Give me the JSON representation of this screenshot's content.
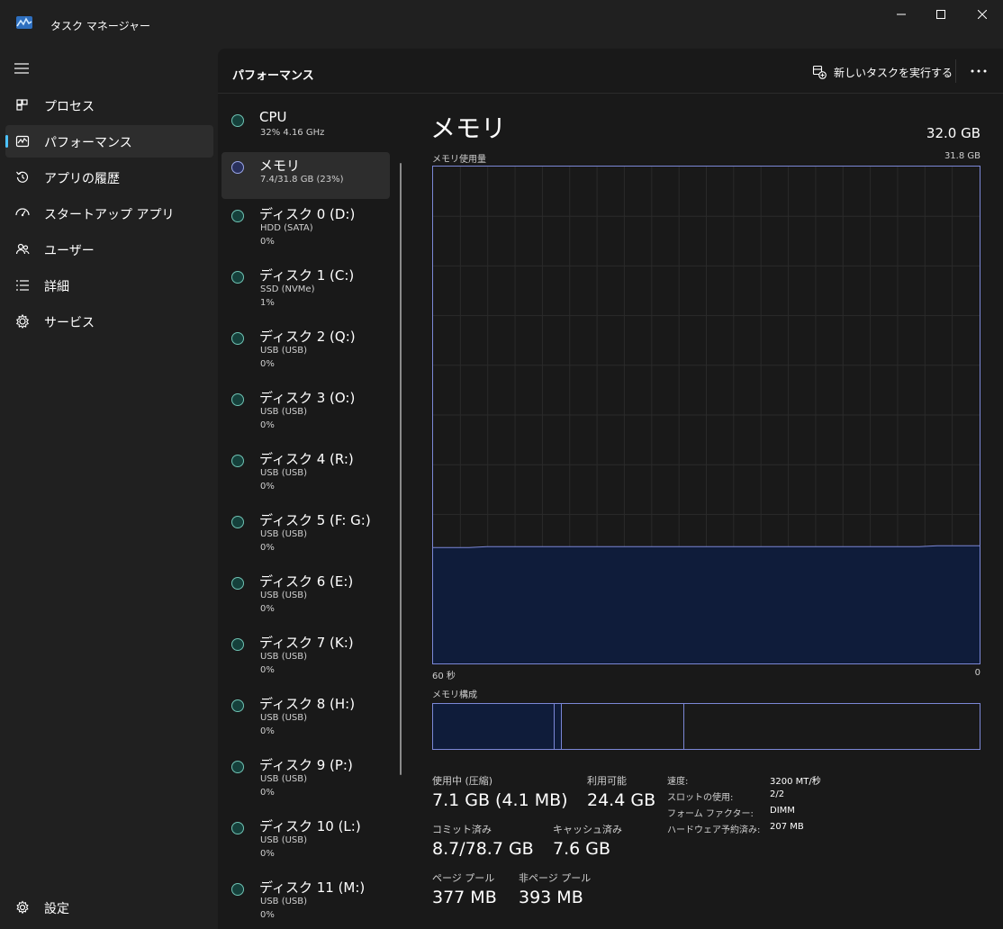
{
  "window": {
    "title": "タスク マネージャー"
  },
  "sidebar": {
    "items": [
      {
        "label": "プロセス",
        "icon": "processes-icon"
      },
      {
        "label": "パフォーマンス",
        "icon": "performance-icon",
        "active": true
      },
      {
        "label": "アプリの履歴",
        "icon": "app-history-icon"
      },
      {
        "label": "スタートアップ アプリ",
        "icon": "startup-icon"
      },
      {
        "label": "ユーザー",
        "icon": "users-icon"
      },
      {
        "label": "詳細",
        "icon": "details-icon"
      },
      {
        "label": "サービス",
        "icon": "services-icon"
      }
    ],
    "settings_label": "設定"
  },
  "header": {
    "title": "パフォーマンス",
    "run_task_label": "新しいタスクを実行する"
  },
  "devices": [
    {
      "name": "CPU",
      "sub": "32%  4.16 GHz",
      "value": ""
    },
    {
      "name": "メモリ",
      "sub": "7.4/31.8 GB (23%)",
      "value": ""
    },
    {
      "name": "ディスク 0 (D:)",
      "sub": "HDD (SATA)",
      "value": "0%"
    },
    {
      "name": "ディスク 1 (C:)",
      "sub": "SSD (NVMe)",
      "value": "1%"
    },
    {
      "name": "ディスク 2 (Q:)",
      "sub": "USB (USB)",
      "value": "0%"
    },
    {
      "name": "ディスク 3 (O:)",
      "sub": "USB (USB)",
      "value": "0%"
    },
    {
      "name": "ディスク 4 (R:)",
      "sub": "USB (USB)",
      "value": "0%"
    },
    {
      "name": "ディスク 5 (F: G:)",
      "sub": "USB (USB)",
      "value": "0%"
    },
    {
      "name": "ディスク 6 (E:)",
      "sub": "USB (USB)",
      "value": "0%"
    },
    {
      "name": "ディスク 7 (K:)",
      "sub": "USB (USB)",
      "value": "0%"
    },
    {
      "name": "ディスク 8 (H:)",
      "sub": "USB (USB)",
      "value": "0%"
    },
    {
      "name": "ディスク 9 (P:)",
      "sub": "USB (USB)",
      "value": "0%"
    },
    {
      "name": "ディスク 10 (L:)",
      "sub": "USB (USB)",
      "value": "0%"
    },
    {
      "name": "ディスク 11 (M:)",
      "sub": "USB (USB)",
      "value": "0%"
    }
  ],
  "memory": {
    "title": "メモリ",
    "total": "32.0 GB",
    "usage_label": "メモリ使用量",
    "usage_max": "31.8 GB",
    "axis_left": "60 秒",
    "axis_right": "0",
    "composition_label": "メモリ構成",
    "usage_level": 0.235,
    "composition": [
      {
        "part": "in-use",
        "fraction": 0.222
      },
      {
        "part": "modified",
        "fraction": 0.013
      },
      {
        "part": "standby",
        "fraction": 0.225
      },
      {
        "part": "free",
        "fraction": 0.54
      }
    ],
    "stats": {
      "in_use_label": "使用中 (圧縮)",
      "in_use_value": "7.1 GB (4.1 MB)",
      "available_label": "利用可能",
      "available_value": "24.4 GB",
      "committed_label": "コミット済み",
      "committed_value": "8.7/78.7 GB",
      "cached_label": "キャッシュ済み",
      "cached_value": "7.6 GB",
      "paged_label": "ページ プール",
      "paged_value": "377 MB",
      "nonpaged_label": "非ページ プール",
      "nonpaged_value": "393 MB"
    },
    "props": {
      "speed_label": "速度:",
      "speed_value": "3200 MT/秒",
      "slots_label": "スロットの使用:",
      "slots_value": "2/2",
      "form_label": "フォーム ファクター:",
      "form_value": "DIMM",
      "reserved_label": "ハードウェア予約済み:",
      "reserved_value": "207 MB"
    }
  },
  "colors": {
    "accent": "#4cc2ff",
    "memory_line": "#7b87d6",
    "memory_fill": "#0f1c3a"
  }
}
